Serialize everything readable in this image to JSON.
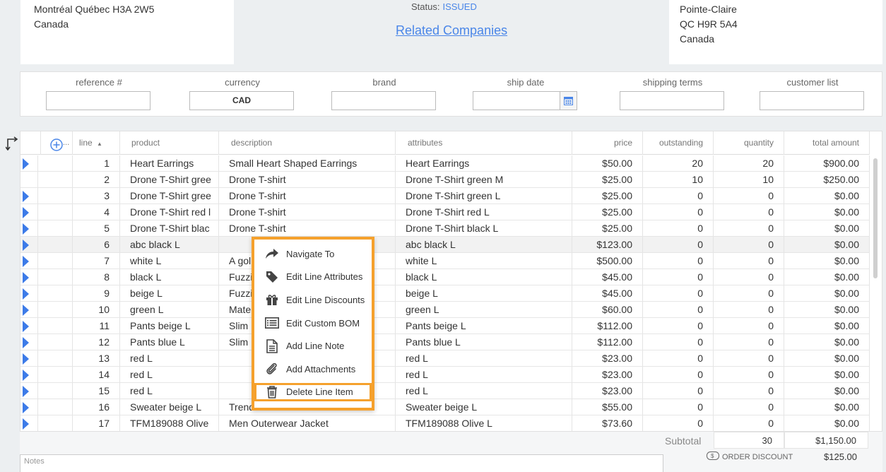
{
  "address_left": {
    "line1": "Montréal Québec H3A 2W5",
    "line2": "Canada"
  },
  "address_right": {
    "line1": "Pointe-Claire",
    "line2": "QC H9R 5A4",
    "line3": "Canada"
  },
  "status": {
    "label": "Status:",
    "value": "ISSUED"
  },
  "related_link": "Related Companies",
  "fields": {
    "reference": {
      "label": "reference #",
      "value": ""
    },
    "currency": {
      "label": "currency",
      "value": "CAD"
    },
    "brand": {
      "label": "brand",
      "value": ""
    },
    "ship_date": {
      "label": "ship date",
      "value": ""
    },
    "shipping_terms": {
      "label": "shipping terms",
      "value": ""
    },
    "customer_list": {
      "label": "customer list",
      "value": ""
    }
  },
  "grid": {
    "add_label": "...",
    "headers": {
      "line": "line",
      "product": "product",
      "description": "description",
      "attributes": "attributes",
      "price": "price",
      "outstanding": "outstanding",
      "quantity": "quantity",
      "total": "total amount"
    },
    "rows": [
      {
        "line": "1",
        "product": "Heart Earrings",
        "description": "Small Heart Shaped Earrings",
        "attributes": "Heart Earrings",
        "price": "$50.00",
        "outstanding": "20",
        "quantity": "20",
        "total": "$900.00"
      },
      {
        "line": "2",
        "product": "Drone T-Shirt gree",
        "description": "Drone T-shirt",
        "attributes": "Drone T-Shirt green M",
        "price": "$25.00",
        "outstanding": "10",
        "quantity": "10",
        "total": "$250.00"
      },
      {
        "line": "3",
        "product": "Drone T-Shirt gree",
        "description": "Drone T-shirt",
        "attributes": "Drone T-Shirt green L",
        "price": "$25.00",
        "outstanding": "0",
        "quantity": "0",
        "total": "$0.00"
      },
      {
        "line": "4",
        "product": "Drone T-Shirt red l",
        "description": "Drone T-shirt",
        "attributes": "Drone T-Shirt red L",
        "price": "$25.00",
        "outstanding": "0",
        "quantity": "0",
        "total": "$0.00"
      },
      {
        "line": "5",
        "product": "Drone T-Shirt blac",
        "description": "Drone T-shirt",
        "attributes": "Drone T-Shirt black L",
        "price": "$25.00",
        "outstanding": "0",
        "quantity": "0",
        "total": "$0.00"
      },
      {
        "line": "6",
        "product": "abc black L",
        "description": "",
        "attributes": "abc black L",
        "price": "$123.00",
        "outstanding": "0",
        "quantity": "0",
        "total": "$0.00"
      },
      {
        "line": "7",
        "product": "white L",
        "description": "A gol",
        "attributes": "white L",
        "price": "$500.00",
        "outstanding": "0",
        "quantity": "0",
        "total": "$0.00"
      },
      {
        "line": "8",
        "product": "black L",
        "description": "Fuzzi",
        "attributes": "black L",
        "price": "$45.00",
        "outstanding": "0",
        "quantity": "0",
        "total": "$0.00"
      },
      {
        "line": "9",
        "product": "beige L",
        "description": "Fuzzi",
        "attributes": "beige L",
        "price": "$45.00",
        "outstanding": "0",
        "quantity": "0",
        "total": "$0.00"
      },
      {
        "line": "10",
        "product": "green L",
        "description": "Mate",
        "attributes": "green L",
        "price": "$60.00",
        "outstanding": "0",
        "quantity": "0",
        "total": "$0.00"
      },
      {
        "line": "11",
        "product": "Pants beige L",
        "description": "Slim",
        "attributes": "Pants beige L",
        "price": "$112.00",
        "outstanding": "0",
        "quantity": "0",
        "total": "$0.00"
      },
      {
        "line": "12",
        "product": "Pants blue L",
        "description": "Slim",
        "attributes": "Pants blue L",
        "price": "$112.00",
        "outstanding": "0",
        "quantity": "0",
        "total": "$0.00"
      },
      {
        "line": "13",
        "product": "red L",
        "description": "",
        "attributes": "red L",
        "price": "$23.00",
        "outstanding": "0",
        "quantity": "0",
        "total": "$0.00"
      },
      {
        "line": "14",
        "product": "red L",
        "description": "",
        "attributes": "red L",
        "price": "$23.00",
        "outstanding": "0",
        "quantity": "0",
        "total": "$0.00"
      },
      {
        "line": "15",
        "product": "red L",
        "description": "",
        "attributes": "red L",
        "price": "$23.00",
        "outstanding": "0",
        "quantity": "0",
        "total": "$0.00"
      },
      {
        "line": "16",
        "product": "Sweater beige L",
        "description": "Trend",
        "attributes": "Sweater beige L",
        "price": "$55.00",
        "outstanding": "0",
        "quantity": "0",
        "total": "$0.00"
      },
      {
        "line": "17",
        "product": "TFM189088 Olive",
        "description": "Men Outerwear Jacket",
        "attributes": "TFM189088 Olive L",
        "price": "$73.60",
        "outstanding": "0",
        "quantity": "0",
        "total": "$0.00"
      }
    ]
  },
  "footer": {
    "subtotal_label": "Subtotal",
    "subtotal_qty": "30",
    "subtotal_amount": "$1,150.00",
    "order_discount_label": "ORDER DISCOUNT",
    "order_discount_amount": "$125.00",
    "notes_placeholder": "Notes"
  },
  "context_menu": {
    "items": [
      {
        "label": "Navigate To",
        "icon": "share-arrow-icon"
      },
      {
        "label": "Edit Line Attributes",
        "icon": "tag-icon"
      },
      {
        "label": "Edit Line Discounts",
        "icon": "gift-icon"
      },
      {
        "label": "Edit Custom BOM",
        "icon": "list-icon"
      },
      {
        "label": "Add Line Note",
        "icon": "document-icon"
      },
      {
        "label": "Add Attachments",
        "icon": "paperclip-icon"
      },
      {
        "label": "Delete Line Item",
        "icon": "trash-icon"
      }
    ]
  },
  "colors": {
    "accent": "#4a86e8",
    "highlight": "#f5a12d",
    "row_arrow": "#3d7be8"
  }
}
